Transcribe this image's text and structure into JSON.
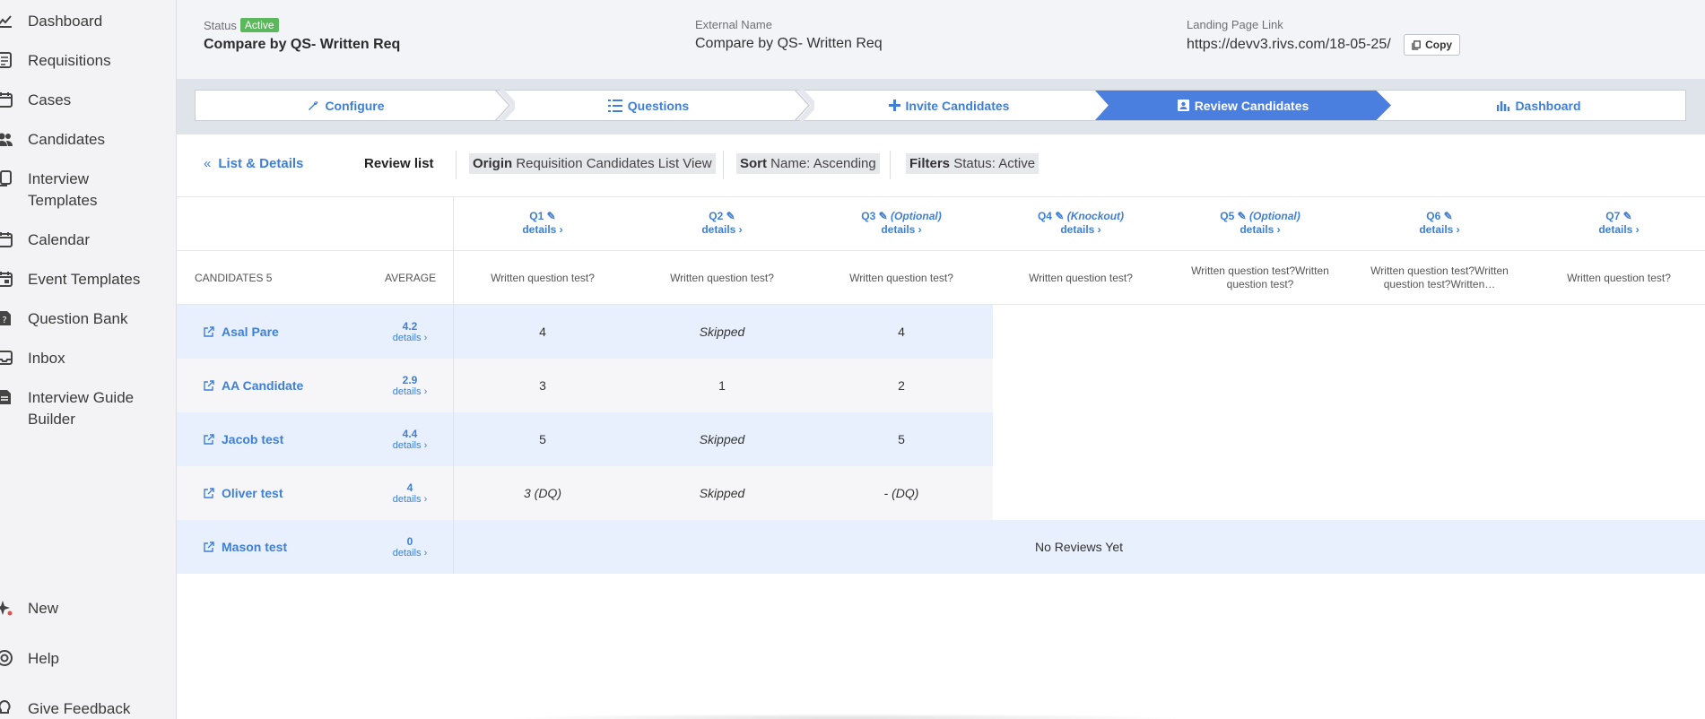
{
  "sidebar": {
    "items": [
      {
        "label": "Dashboard",
        "icon": "chart-line-icon"
      },
      {
        "label": "Requisitions",
        "icon": "list-document-icon"
      },
      {
        "label": "Cases",
        "icon": "calendar-icon"
      },
      {
        "label": "Candidates",
        "icon": "users-icon"
      },
      {
        "label": "Interview Templates",
        "icon": "copy-icon"
      },
      {
        "label": "Calendar",
        "icon": "calendar-icon"
      },
      {
        "label": "Event Templates",
        "icon": "calendar-event-icon"
      },
      {
        "label": "Question Bank",
        "icon": "question-document-icon"
      },
      {
        "label": "Inbox",
        "icon": "inbox-icon"
      },
      {
        "label": "Interview Guide Builder",
        "icon": "document-icon"
      }
    ],
    "bottom": [
      {
        "label": "New",
        "icon": "sparkle-icon"
      },
      {
        "label": "Help",
        "icon": "lifebuoy-icon"
      },
      {
        "label": "Give Feedback",
        "icon": "lightbulb-icon"
      }
    ]
  },
  "header": {
    "status_label": "Status",
    "status_badge": "Active",
    "req_name": "Compare by QS- Written Req",
    "external_label": "External Name",
    "external_value": "Compare by QS- Written Req",
    "landing_label": "Landing Page Link",
    "landing_value": "https://devv3.rivs.com/18-05-25/",
    "copy_label": "Copy"
  },
  "wizard": {
    "steps": [
      {
        "label": "Configure",
        "icon": "wrench-icon"
      },
      {
        "label": "Questions",
        "icon": "list-icon"
      },
      {
        "label": "Invite Candidates",
        "icon": "plus-icon"
      },
      {
        "label": "Review Candidates",
        "icon": "user-card-icon",
        "active": true
      },
      {
        "label": "Dashboard",
        "icon": "bar-chart-icon"
      }
    ]
  },
  "toolbar": {
    "back_label": "List & Details",
    "review_list": "Review list",
    "origin_key": "Origin",
    "origin_value": "Requisition Candidates List View",
    "sort_key": "Sort",
    "sort_value": "Name: Ascending",
    "filters_key": "Filters",
    "filters_value": "Status: Active"
  },
  "table": {
    "candidates_header": "CANDIDATES 5",
    "average_header": "AVERAGE",
    "details_label": "details",
    "questions": [
      {
        "id": "Q1",
        "tag": "",
        "text": "Written question test?"
      },
      {
        "id": "Q2",
        "tag": "",
        "text": "Written question test?"
      },
      {
        "id": "Q3",
        "tag": "(Optional)",
        "text": "Written question test?"
      },
      {
        "id": "Q4",
        "tag": "(Knockout)",
        "text": "Written question test?"
      },
      {
        "id": "Q5",
        "tag": "(Optional)",
        "text": "Written question test?Written question test?"
      },
      {
        "id": "Q6",
        "tag": "",
        "text": "Written question test?Written question test?Written…"
      },
      {
        "id": "Q7",
        "tag": "",
        "text": "Written question test?"
      }
    ],
    "rows": [
      {
        "name": "Asal Pare",
        "avg": "4.2",
        "scores": [
          "4",
          "Skipped",
          "4"
        ]
      },
      {
        "name": "AA Candidate",
        "avg": "2.9",
        "scores": [
          "3",
          "1",
          "2"
        ]
      },
      {
        "name": "Jacob test",
        "avg": "4.4",
        "scores": [
          "5",
          "Skipped",
          "5"
        ]
      },
      {
        "name": "Oliver test",
        "avg": "4",
        "scores": [
          "3 (DQ)",
          "Skipped",
          "- (DQ)"
        ]
      },
      {
        "name": "Mason test",
        "avg": "0",
        "scores": []
      }
    ],
    "no_reviews": "No Reviews Yet"
  }
}
